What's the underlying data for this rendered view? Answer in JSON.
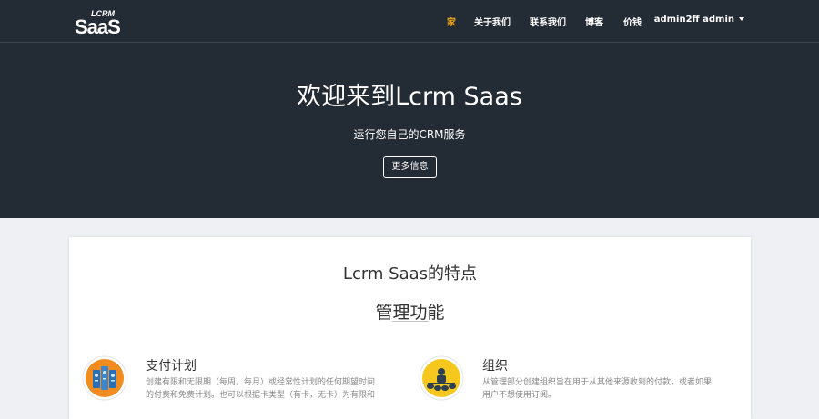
{
  "brand": {
    "logo_text": "SaaS",
    "logo_small": "LCRM"
  },
  "nav": {
    "items": [
      {
        "label": "家"
      },
      {
        "label": "关于我们"
      },
      {
        "label": "联系我们"
      },
      {
        "label": "博客"
      },
      {
        "label": "价钱"
      }
    ],
    "user": "admin2ff admin"
  },
  "hero": {
    "title": "欢迎来到Lcrm Saas",
    "subtitle": "运行您自己的CRM服务",
    "button": "更多信息"
  },
  "features": {
    "title": "Lcrm Saas的特点",
    "subtitle": "管理功能",
    "items": [
      {
        "title": "支付计划",
        "text_line1": "创建有限和无限期（每周，每月）或经常性计划的任何期望时间",
        "text_line2": "的付费和免费计划。也可以根据卡类型（有卡，无卡）为有限和",
        "icon": "payment-plan-icon"
      },
      {
        "title": "组织",
        "text_line1": "从管理部分创建组织旨在用于从其他来源收到的付款，或者如果",
        "text_line2": "用户不想使用订阅。",
        "icon": "organization-icon"
      }
    ]
  },
  "colors": {
    "hero_bg": "#232b35",
    "nav_active": "#f0a818",
    "page_bg": "#eef0f3"
  }
}
